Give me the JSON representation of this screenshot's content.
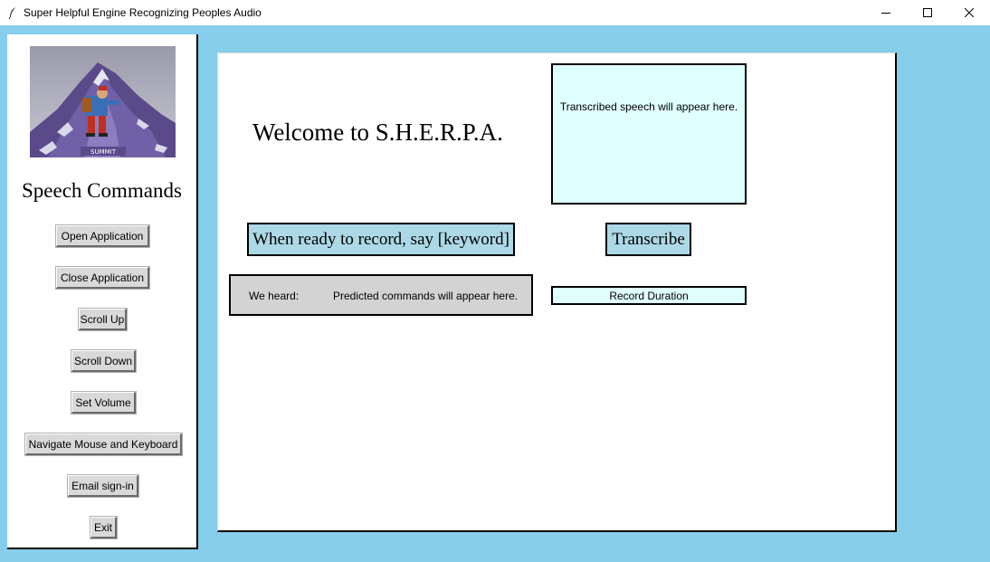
{
  "window": {
    "title": "Super Helpful Engine Recognizing Peoples Audio",
    "icon": "feather-icon",
    "controls": [
      "minimize-icon",
      "maximize-icon",
      "close-icon"
    ]
  },
  "sidebar": {
    "logo_caption": "SUMMIT",
    "title": "Speech Commands",
    "buttons": [
      "Open Application",
      "Close Application",
      "Scroll Up",
      "Scroll Down",
      "Set Volume",
      "Navigate Mouse and Keyboard",
      "Email sign-in",
      "Exit"
    ]
  },
  "main": {
    "welcome": "Welcome to S.H.E.R.P.A.",
    "transcript_placeholder": "Transcribed speech will appear here.",
    "keyword_prompt": "When ready to record, say [keyword]",
    "transcribe_label": "Transcribe",
    "heard_label": "We heard:",
    "heard_value": "Predicted commands will appear here.",
    "duration_label": "Record Duration"
  },
  "colors": {
    "background": "#87ceeb",
    "panel": "#ffffff",
    "accent_button": "#add8e6",
    "light_box": "#e0ffff",
    "heard_box": "#d3d3d3",
    "system_button": "#d9d9d9"
  }
}
